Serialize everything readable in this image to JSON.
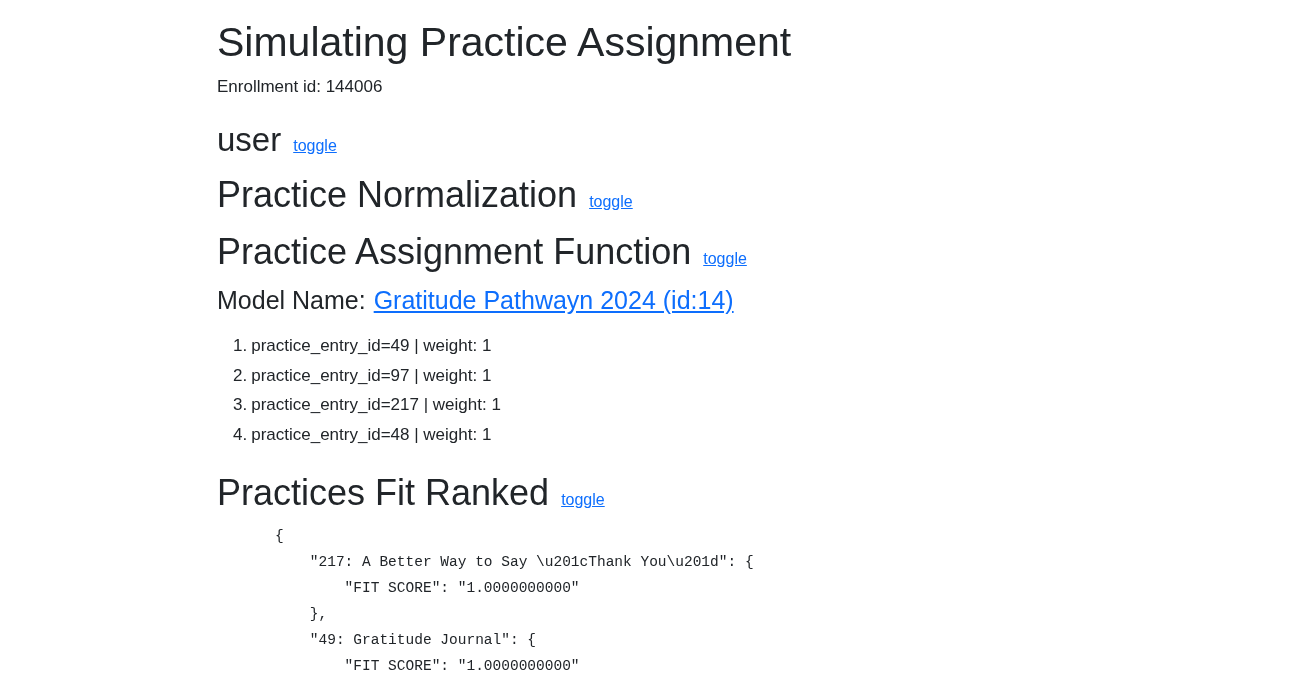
{
  "title": "Simulating Practice Assignment",
  "enrollment": "Enrollment id: 144006",
  "sections_top": [
    {
      "heading": "user",
      "toggle": "toggle"
    },
    {
      "heading": "Practice Normalization",
      "toggle": "toggle"
    },
    {
      "heading": "Practice Assignment Function",
      "toggle": "toggle"
    }
  ],
  "model": {
    "label": "Model Name:",
    "link": "Gratitude Pathwayn 2024 (id:14)"
  },
  "entries": [
    {
      "number": "1.",
      "text": "practice_entry_id=49 | weight: 1"
    },
    {
      "number": "2.",
      "text": "practice_entry_id=97 | weight: 1"
    },
    {
      "number": "3.",
      "text": "practice_entry_id=217 | weight: 1"
    },
    {
      "number": "4.",
      "text": "practice_entry_id=48 | weight: 1"
    }
  ],
  "ranked": {
    "heading": "Practices Fit Ranked",
    "toggle": "toggle",
    "lines": [
      "{",
      "    \"217: A Better Way to Say \\u201cThank You\\u201d\": {",
      "        \"FIT SCORE\": \"1.0000000000\"",
      "    },",
      "    \"49: Gratitude Journal\": {",
      "        \"FIT SCORE\": \"1.0000000000\""
    ]
  }
}
